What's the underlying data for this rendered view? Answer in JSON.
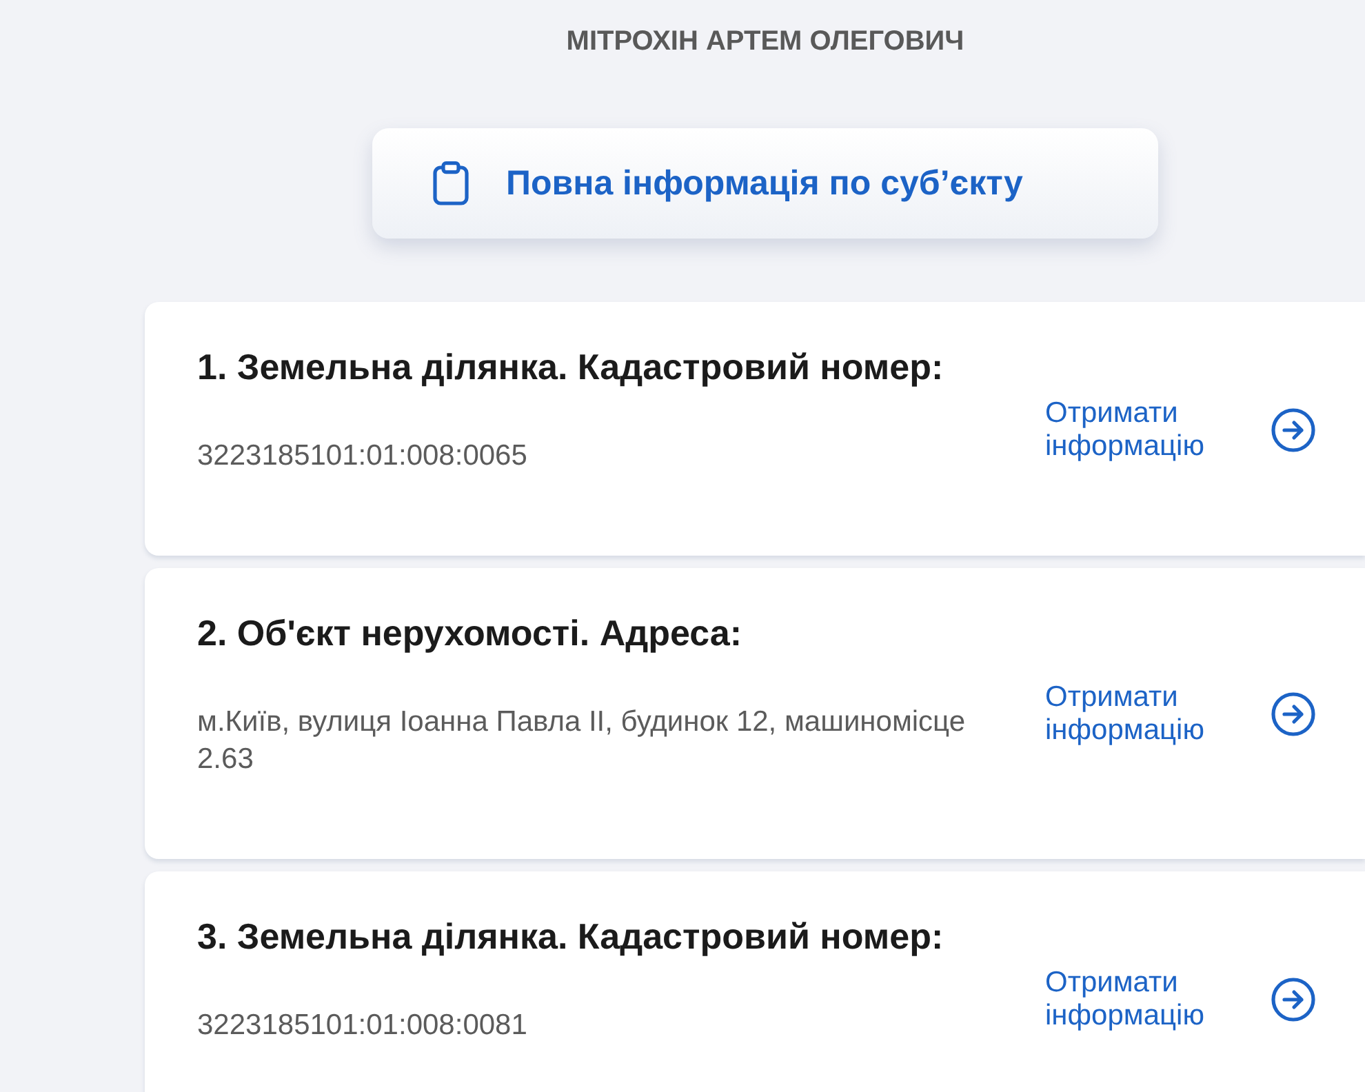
{
  "subject_name": "МІТРОХІН АРТЕМ ОЛЕГОВИЧ",
  "full_info_button": {
    "label": "Повна інформація по суб’єкту"
  },
  "objects": [
    {
      "title": "1. Земельна ділянка. Кадастровий номер:",
      "value": "3223185101:01:008:0065",
      "link": "Отримати інформацію"
    },
    {
      "title": "2. Об'єкт нерухомості. Адреса:",
      "value": "м.Київ, вулиця Іоанна Павла ІІ, будинок 12, машиномісце 2.63",
      "link": "Отримати інформацію"
    },
    {
      "title": "3. Земельна ділянка. Кадастровий номер:",
      "value": "3223185101:01:008:0081",
      "link": "Отримати інформацію"
    }
  ]
}
